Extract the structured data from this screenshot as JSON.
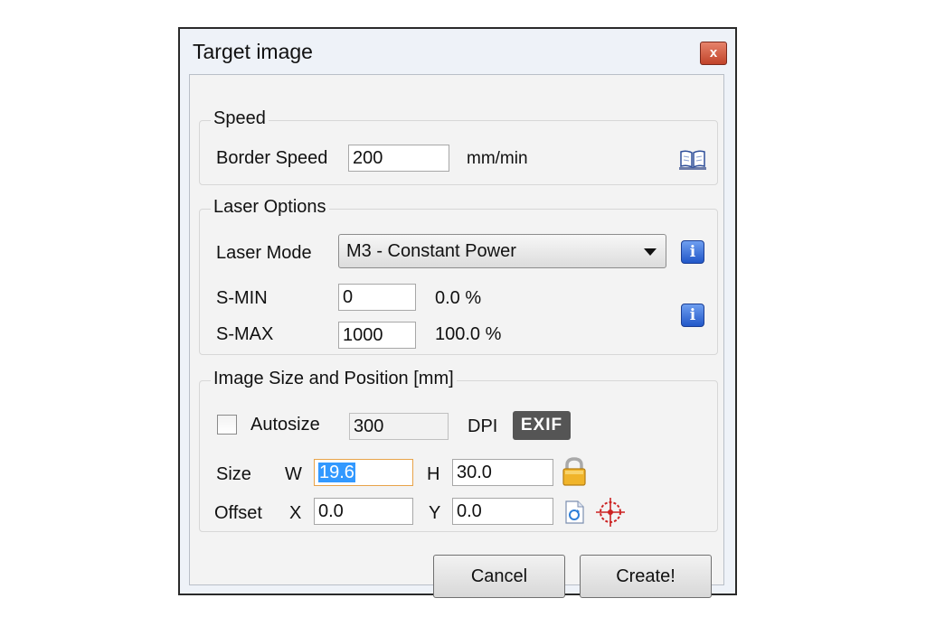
{
  "window": {
    "title": "Target image",
    "close_label": "x"
  },
  "speed": {
    "group_title": "Speed",
    "border_speed_label": "Border Speed",
    "border_speed_value": "200",
    "unit": "mm/min",
    "help_icon": "book-icon"
  },
  "laser": {
    "group_title": "Laser Options",
    "mode_label": "Laser Mode",
    "mode_value": "M3 - Constant Power",
    "info_glyph": "i",
    "smin_label": "S-MIN",
    "smin_value": "0",
    "smin_percent": "0.0 %",
    "smax_label": "S-MAX",
    "smax_value": "1000",
    "smax_percent": "100.0 %"
  },
  "image": {
    "group_title": "Image Size and Position [mm]",
    "autosize_label": "Autosize",
    "autosize_checked": false,
    "dpi_value": "300",
    "dpi_label": "DPI",
    "exif_label": "EXIF",
    "size_label": "Size",
    "w_label": "W",
    "w_value": "19.6",
    "h_label": "H",
    "h_value": "30.0",
    "offset_label": "Offset",
    "x_label": "X",
    "x_value": "0.0",
    "y_label": "Y",
    "y_value": "0.0"
  },
  "buttons": {
    "cancel": "Cancel",
    "create": "Create!"
  },
  "colors": {
    "info_blue": "#2157c8",
    "lock_gold": "#e2a21c",
    "crosshair_red": "#cc2222",
    "close_red": "#c1432a"
  }
}
